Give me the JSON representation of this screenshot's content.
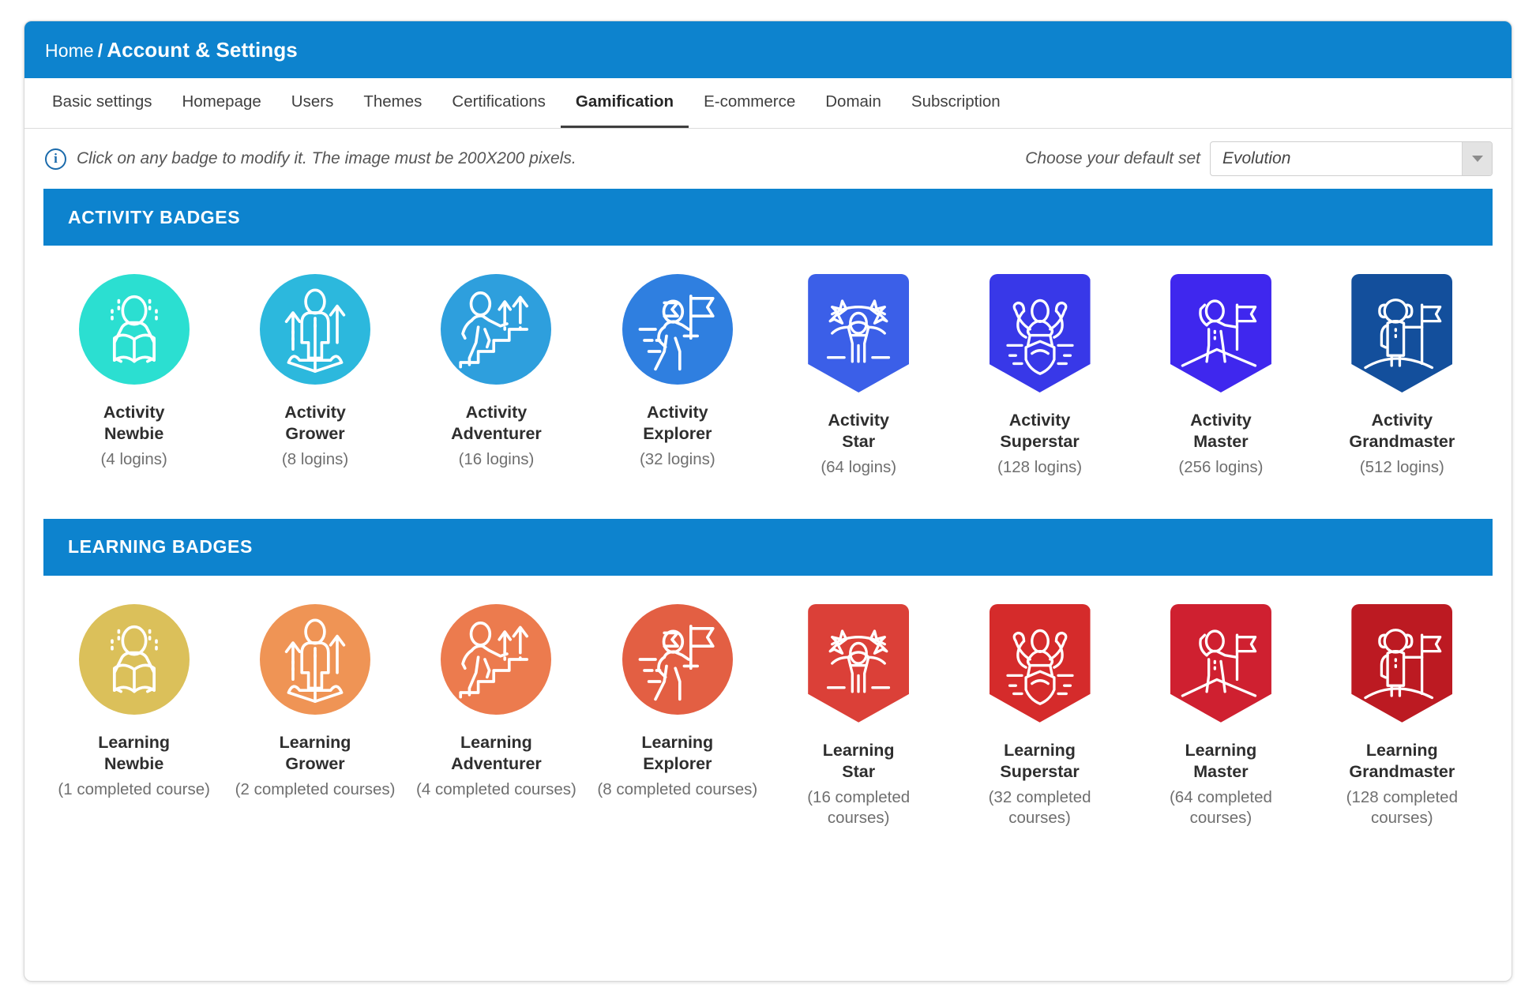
{
  "header": {
    "breadcrumb_home": "Home",
    "breadcrumb_separator": "/",
    "breadcrumb_current": "Account & Settings",
    "bar_color": "#0d83ce"
  },
  "tabs": [
    {
      "label": "Basic settings",
      "active": false
    },
    {
      "label": "Homepage",
      "active": false
    },
    {
      "label": "Users",
      "active": false
    },
    {
      "label": "Themes",
      "active": false
    },
    {
      "label": "Certifications",
      "active": false
    },
    {
      "label": "Gamification",
      "active": true
    },
    {
      "label": "E-commerce",
      "active": false
    },
    {
      "label": "Domain",
      "active": false
    },
    {
      "label": "Subscription",
      "active": false
    }
  ],
  "info": {
    "icon": "info-circle-icon",
    "glyph": "i",
    "text": "Click on any badge to modify it. The image must be 200X200 pixels.",
    "icon_color": "#1a6aab"
  },
  "default_set": {
    "label": "Choose your default set",
    "value": "Evolution",
    "options": [
      "Evolution"
    ],
    "arrow_icon": "chevron-down-icon"
  },
  "sections": [
    {
      "id": "activity",
      "title": "ACTIVITY BADGES",
      "title_bar_color": "#0d83ce",
      "badges": [
        {
          "title_line1": "Activity",
          "title_line2": "Newbie",
          "sub": "(4 logins)",
          "color": "#2bdfd1",
          "shape": "circle",
          "icon": "reader-badge-icon"
        },
        {
          "title_line1": "Activity",
          "title_line2": "Grower",
          "sub": "(8 logins)",
          "color": "#2cb8dd",
          "shape": "circle",
          "icon": "growth-badge-icon"
        },
        {
          "title_line1": "Activity",
          "title_line2": "Adventurer",
          "sub": "(16 logins)",
          "color": "#2e9fdd",
          "shape": "circle",
          "icon": "stairs-badge-icon"
        },
        {
          "title_line1": "Activity",
          "title_line2": "Explorer",
          "sub": "(32 logins)",
          "color": "#2f7fe0",
          "shape": "circle",
          "icon": "flag-runner-badge-icon"
        },
        {
          "title_line1": "Activity",
          "title_line2": "Star",
          "sub": "(64 logins)",
          "color": "#3b5fe8",
          "shape": "pennant",
          "icon": "celebrate-badge-icon"
        },
        {
          "title_line1": "Activity",
          "title_line2": "Superstar",
          "sub": "(128 logins)",
          "color": "#3838e8",
          "shape": "pennant",
          "icon": "muscle-shield-badge-icon"
        },
        {
          "title_line1": "Activity",
          "title_line2": "Master",
          "sub": "(256 logins)",
          "color": "#3f27ee",
          "shape": "pennant",
          "icon": "summit-flag-badge-icon"
        },
        {
          "title_line1": "Activity",
          "title_line2": "Grandmaster",
          "sub": "(512 logins)",
          "color": "#134f9c",
          "shape": "pennant",
          "icon": "astronaut-flag-badge-icon"
        }
      ]
    },
    {
      "id": "learning",
      "title": "LEARNING BADGES",
      "title_bar_color": "#0d83ce",
      "badges": [
        {
          "title_line1": "Learning",
          "title_line2": "Newbie",
          "sub": "(1 completed course)",
          "color": "#dbc05a",
          "shape": "circle",
          "icon": "reader-badge-icon"
        },
        {
          "title_line1": "Learning",
          "title_line2": "Grower",
          "sub": "(2 completed courses)",
          "color": "#ef9455",
          "shape": "circle",
          "icon": "growth-badge-icon"
        },
        {
          "title_line1": "Learning",
          "title_line2": "Adventurer",
          "sub": "(4 completed courses)",
          "color": "#ec7b4e",
          "shape": "circle",
          "icon": "stairs-badge-icon"
        },
        {
          "title_line1": "Learning",
          "title_line2": "Explorer",
          "sub": "(8 completed courses)",
          "color": "#e35f43",
          "shape": "circle",
          "icon": "flag-runner-badge-icon"
        },
        {
          "title_line1": "Learning",
          "title_line2": "Star",
          "sub": "(16 completed courses)",
          "color": "#db4038",
          "shape": "pennant",
          "icon": "celebrate-badge-icon"
        },
        {
          "title_line1": "Learning",
          "title_line2": "Superstar",
          "sub": "(32 completed courses)",
          "color": "#d52b2b",
          "shape": "pennant",
          "icon": "muscle-shield-badge-icon"
        },
        {
          "title_line1": "Learning",
          "title_line2": "Master",
          "sub": "(64 completed courses)",
          "color": "#cf2030",
          "shape": "pennant",
          "icon": "summit-flag-badge-icon"
        },
        {
          "title_line1": "Learning",
          "title_line2": "Grandmaster",
          "sub": "(128 completed courses)",
          "color": "#bc1a22",
          "shape": "pennant",
          "icon": "astronaut-flag-badge-icon"
        }
      ]
    }
  ]
}
